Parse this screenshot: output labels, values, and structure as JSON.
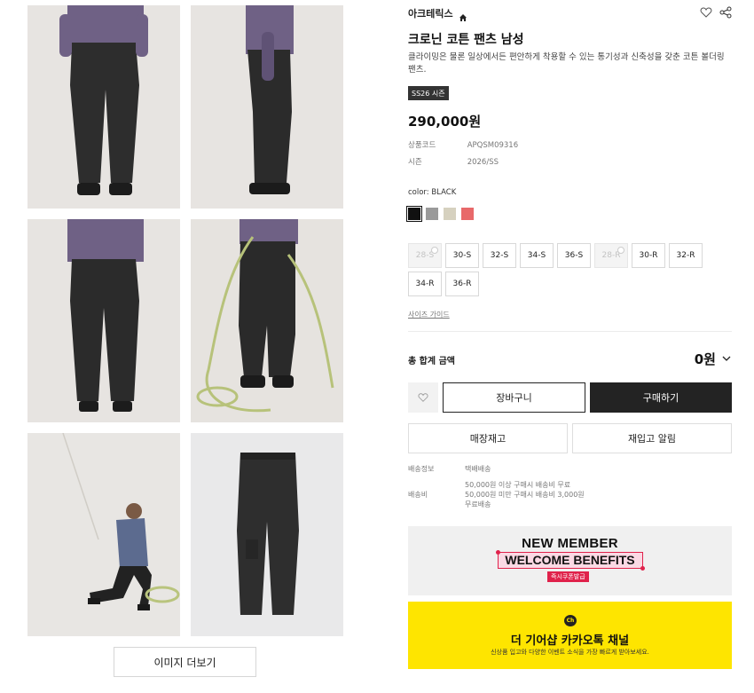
{
  "gallery": {
    "photos": [
      "front-view",
      "side-view",
      "back-view",
      "climbing-rope-detail",
      "rope-pulling",
      "product-flat"
    ],
    "more_label": "이미지 더보기"
  },
  "product": {
    "brand": "아크테릭스",
    "title": "크로닌 코튼 팬츠 남성",
    "description": "클라이밍은 물론 일상에서든 편안하게 착용할 수 있는 통기성과 신축성을 갖춘 코튼 볼더링 팬츠.",
    "season_badge": "SS26 시즌",
    "price": "290,000원",
    "specs": [
      {
        "label": "상품코드",
        "value": "APQSM09316"
      },
      {
        "label": "시즌",
        "value": "2026/SS"
      }
    ],
    "color_label": "color: BLACK",
    "colors": [
      "#111111",
      "#9a9a9a",
      "#d6d1bf",
      "#e8696a"
    ],
    "sizes": [
      {
        "label": "28-S",
        "disabled": true
      },
      {
        "label": "30-S",
        "disabled": false
      },
      {
        "label": "32-S",
        "disabled": false
      },
      {
        "label": "34-S",
        "disabled": false
      },
      {
        "label": "36-S",
        "disabled": false
      },
      {
        "label": "28-R",
        "disabled": true
      },
      {
        "label": "30-R",
        "disabled": false
      },
      {
        "label": "32-R",
        "disabled": false
      },
      {
        "label": "34-R",
        "disabled": false
      },
      {
        "label": "36-R",
        "disabled": false
      }
    ],
    "size_guide": "사이즈 가이드"
  },
  "order": {
    "total_label": "총 합계 금액",
    "total_value": "0원",
    "cart_label": "장바구니",
    "buy_label": "구매하기",
    "store_stock_label": "매장재고",
    "restock_label": "재입고 알림"
  },
  "shipping": {
    "info_label": "배송정보",
    "info_value": "택배배송",
    "fee_label": "배송비",
    "fee_lines": [
      "50,000원 이상 구매시 배송비 무료",
      "50,000원 미만 구매시 배송비 3,000원",
      "무료배송"
    ]
  },
  "banners": {
    "member_title": "NEW MEMBER",
    "member_sub": "WELCOME BENEFITS",
    "member_pill": "즉시쿠폰발급",
    "kakao_logo": "Ch",
    "kakao_title": "더 기어샵 카카오톡 채널",
    "kakao_sub": "신상품 입고와 다양한 이벤트 소식을 가장 빠르게 받아보세요."
  },
  "colors": {
    "accent_dark": "#232323",
    "member_red": "#e0224b",
    "kakao_yellow": "#fee500"
  }
}
